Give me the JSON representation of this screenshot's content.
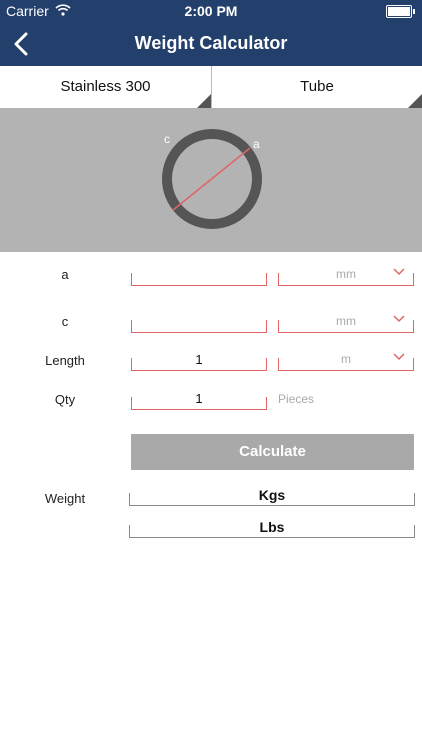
{
  "status_bar": {
    "carrier": "Carrier",
    "time": "2:00 PM"
  },
  "header": {
    "title": "Weight Calculator",
    "background": "#233f6b"
  },
  "selectors": {
    "material": "Stainless 300",
    "shape": "Tube"
  },
  "diagram": {
    "label_c": "c",
    "label_a": "a"
  },
  "form": {
    "a": {
      "label": "a",
      "value": "",
      "unit": "mm"
    },
    "c": {
      "label": "c",
      "value": "",
      "unit": "mm"
    },
    "length": {
      "label": "Length",
      "value": "1",
      "unit": "m"
    },
    "qty": {
      "label": "Qty",
      "value": "1",
      "unit": "Pieces"
    }
  },
  "calculate_label": "Calculate",
  "weight": {
    "label": "Weight",
    "kgs": "Kgs",
    "lbs": "Lbs"
  }
}
